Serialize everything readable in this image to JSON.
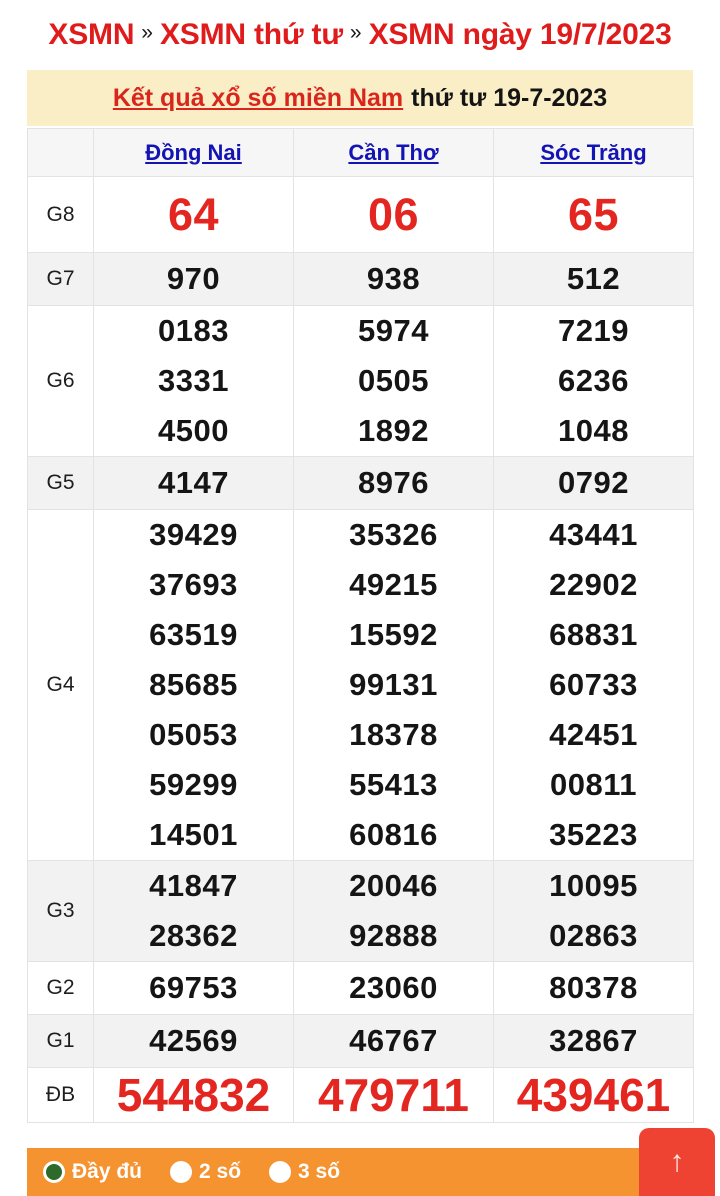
{
  "breadcrumb": {
    "items": [
      "XSMN",
      "XSMN thứ tư",
      "XSMN ngày 19/7/2023"
    ],
    "separator": "»"
  },
  "banner": {
    "link_text": "Kết quả xổ số miền Nam",
    "plain_text": "thứ tư 19-7-2023"
  },
  "table": {
    "label_header": "",
    "provinces": [
      "Đồng Nai",
      "Cần Thơ",
      "Sóc Trăng"
    ],
    "rows": [
      {
        "label": "G8",
        "style": "big-red",
        "cells": [
          [
            "64"
          ],
          [
            "06"
          ],
          [
            "65"
          ]
        ]
      },
      {
        "label": "G7",
        "style": "normal",
        "cells": [
          [
            "970"
          ],
          [
            "938"
          ],
          [
            "512"
          ]
        ]
      },
      {
        "label": "G6",
        "style": "normal",
        "cells": [
          [
            "0183",
            "3331",
            "4500"
          ],
          [
            "5974",
            "0505",
            "1892"
          ],
          [
            "7219",
            "6236",
            "1048"
          ]
        ]
      },
      {
        "label": "G5",
        "style": "normal",
        "cells": [
          [
            "4147"
          ],
          [
            "8976"
          ],
          [
            "0792"
          ]
        ]
      },
      {
        "label": "G4",
        "style": "normal",
        "cells": [
          [
            "39429",
            "37693",
            "63519",
            "85685",
            "05053",
            "59299",
            "14501"
          ],
          [
            "35326",
            "49215",
            "15592",
            "99131",
            "18378",
            "55413",
            "60816"
          ],
          [
            "43441",
            "22902",
            "68831",
            "60733",
            "42451",
            "00811",
            "35223"
          ]
        ]
      },
      {
        "label": "G3",
        "style": "normal",
        "cells": [
          [
            "41847",
            "28362"
          ],
          [
            "20046",
            "92888"
          ],
          [
            "10095",
            "02863"
          ]
        ]
      },
      {
        "label": "G2",
        "style": "normal",
        "cells": [
          [
            "69753"
          ],
          [
            "23060"
          ],
          [
            "80378"
          ]
        ]
      },
      {
        "label": "G1",
        "style": "normal",
        "cells": [
          [
            "42569"
          ],
          [
            "46767"
          ],
          [
            "32867"
          ]
        ]
      },
      {
        "label": "ĐB",
        "style": "db-red",
        "cells": [
          [
            "544832"
          ],
          [
            "479711"
          ],
          [
            "439461"
          ]
        ]
      }
    ]
  },
  "bottom_bar": {
    "options": [
      {
        "label": "Đầy đủ",
        "selected": true
      },
      {
        "label": "2 số",
        "selected": false
      },
      {
        "label": "3 số",
        "selected": false
      }
    ],
    "scroll_top_icon": "up-arrow-icon",
    "scroll_top_glyph": "↑"
  },
  "colors": {
    "title_red": "#e01b1b",
    "banner_bg": "#faeec6",
    "link_blue": "#1414b4",
    "prize_red": "#e42620",
    "bar_orange": "#f59331",
    "scroll_red": "#ee4233",
    "selected_green": "#2e6b2b"
  }
}
